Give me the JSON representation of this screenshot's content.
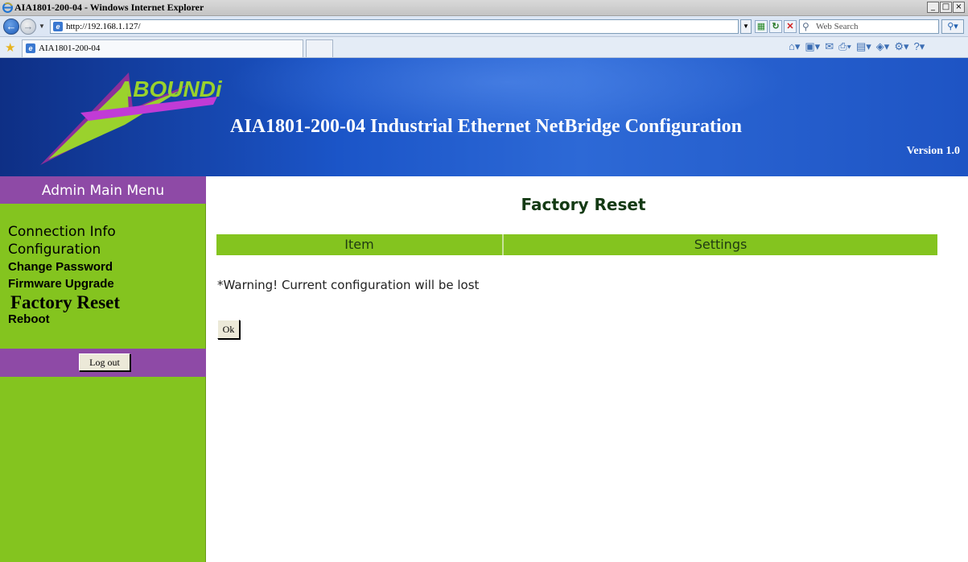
{
  "window": {
    "title": "AIA1801-200-04 - Windows Internet Explorer",
    "controls": [
      "_",
      "□",
      "×"
    ]
  },
  "address_bar": {
    "url": "http://192.168.1.127/",
    "search_placeholder": "Web Search"
  },
  "tabs": [
    {
      "label": "AIA1801-200-04"
    }
  ],
  "banner": {
    "logo_text": "ABOUNDi",
    "title": "AIA1801-200-04 Industrial Ethernet NetBridge Configuration",
    "version": "Version 1.0"
  },
  "sidebar": {
    "header": "Admin Main Menu",
    "items": [
      {
        "label": "Connection Info"
      },
      {
        "label": "Configuration"
      },
      {
        "label": "Change Password"
      },
      {
        "label": "Firmware Upgrade"
      },
      {
        "label": "Factory Reset",
        "active": true
      },
      {
        "label": "Reboot"
      }
    ],
    "logout_label": "Log out"
  },
  "main": {
    "title": "Factory Reset",
    "table": {
      "columns": [
        "Item",
        "Settings"
      ]
    },
    "warning": "*Warning! Current configuration will be lost",
    "ok_label": "Ok"
  },
  "colors": {
    "sidebar_green": "#84c41f",
    "menu_purple": "#8e4aa6",
    "banner_blue": "#1b55c8",
    "title_dark_green": "#143a14"
  }
}
